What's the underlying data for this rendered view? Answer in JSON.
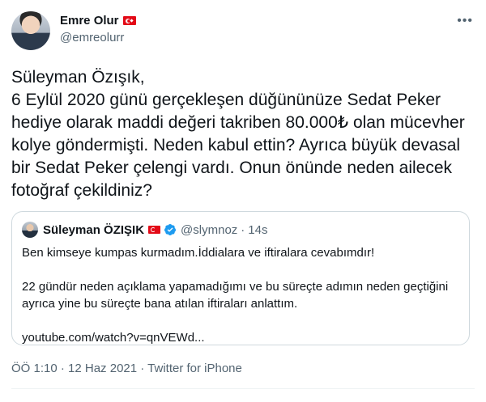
{
  "author": {
    "name": "Emre Olur",
    "handle": "@emreolurr",
    "flag_icon": "turkey-flag-icon"
  },
  "tweet": {
    "text": "Süleyman Özışık,\n6 Eylül 2020 günü gerçekleşen düğününüze Sedat Peker hediye olarak maddi değeri takriben 80.000₺ olan mücevher kolye göndermişti. Neden kabul ettin? Ayrıca büyük devasal bir Sedat Peker çelengi vardı. Onun önünde neden ailecek fotoğraf çekildiniz?"
  },
  "quoted": {
    "name": "Süleyman ÖZIŞIK",
    "handle": "@slymnoz",
    "separator": "·",
    "time": "14s",
    "paragraphs": [
      "Ben kimseye kumpas kurmadım.İddialara ve iftiralara cevabımdır!",
      "22 gündür neden açıklama yapamadığımı ve bu süreçte adımın neden geçtiğini ayrıca yine bu süreçte bana atılan iftiraları anlattım.",
      "youtube.com/watch?v=qnVEWd..."
    ]
  },
  "meta": {
    "timestamp": "ÖÖ 1:10 · 12 Haz 2021 · Twitter for iPhone"
  },
  "colors": {
    "text": "#0f1419",
    "secondary": "#536471",
    "border": "#cfd9de",
    "verified": "#1d9bf0",
    "flag": "#e30a17"
  }
}
